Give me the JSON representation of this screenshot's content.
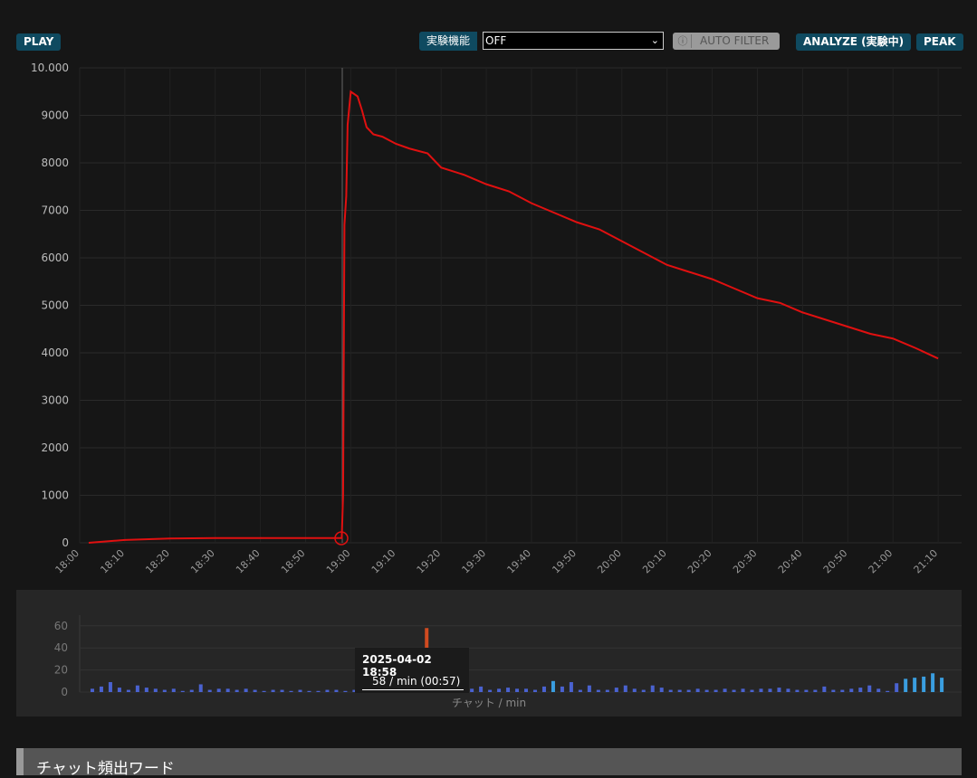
{
  "toolbar": {
    "play": "PLAY",
    "experimental_label": "実験機能",
    "select_value": "OFF",
    "auto_filter": "AUTO FILTER",
    "analyze": "ANALYZE (実験中)",
    "peak": "PEAK"
  },
  "tooltip": {
    "title": "2025-04-02 18:58",
    "value": "58 / min (00:57)"
  },
  "section": {
    "title": "チャット頻出ワード"
  },
  "colors": {
    "line": "#e01010",
    "bar": "#4a62d0",
    "bar_high": "#3a9ee0",
    "bar_peak": "#d04a20",
    "bar_hover": "#40d0b0"
  },
  "chart_data": [
    {
      "type": "line",
      "ylim": [
        0,
        10000
      ],
      "yticks": [
        "0",
        "1000",
        "2000",
        "3000",
        "4000",
        "5000",
        "6000",
        "7000",
        "8000",
        "9000",
        "10.000"
      ],
      "xticks": [
        "18:00",
        "18:10",
        "18:20",
        "18:30",
        "18:40",
        "18:50",
        "19:00",
        "19:10",
        "19:20",
        "19:30",
        "19:40",
        "19:50",
        "20:00",
        "20:10",
        "20:20",
        "20:30",
        "20:40",
        "20:50",
        "21:00",
        "21:10"
      ],
      "x_minutes": [
        2,
        10,
        20,
        30,
        40,
        50,
        57,
        58,
        58.3,
        58.6,
        59,
        59.3,
        60,
        61.5,
        62.5,
        63.5,
        65,
        67,
        70,
        73,
        77,
        80,
        85,
        90,
        95,
        100,
        105,
        110,
        115,
        120,
        125,
        130,
        135,
        140,
        145,
        150,
        155,
        160,
        165,
        170,
        175,
        180,
        185,
        190
      ],
      "values": [
        0,
        60,
        90,
        100,
        100,
        100,
        100,
        100,
        1000,
        6700,
        7300,
        8800,
        9500,
        9400,
        9100,
        8750,
        8600,
        8550,
        8400,
        8300,
        8200,
        7900,
        7750,
        7550,
        7400,
        7150,
        6950,
        6750,
        6600,
        6350,
        6100,
        5850,
        5700,
        5550,
        5350,
        5150,
        5050,
        4850,
        4700,
        4550,
        4400,
        4300,
        4100,
        3880
      ]
    },
    {
      "type": "bar",
      "ylim": [
        0,
        70
      ],
      "yticks": [
        "0",
        "20",
        "40",
        "60"
      ],
      "xlabel": "チャット / min",
      "x_start_minute": 3,
      "x_step_minutes": 2,
      "values": [
        3,
        5,
        9,
        4,
        2,
        6,
        4,
        3,
        2,
        3,
        1,
        2,
        7,
        2,
        3,
        3,
        2,
        3,
        2,
        1,
        2,
        2,
        1,
        2,
        1,
        1,
        2,
        2,
        1,
        2,
        3,
        2,
        2,
        3,
        5,
        6,
        13,
        58,
        5,
        17,
        12,
        11,
        3,
        5,
        2,
        3,
        4,
        3,
        3,
        2,
        5,
        10,
        5,
        9,
        2,
        6,
        2,
        2,
        4,
        6,
        3,
        2,
        6,
        4,
        2,
        2,
        2,
        3,
        2,
        2,
        3,
        2,
        3,
        2,
        3,
        3,
        4,
        3,
        2,
        2,
        2,
        5,
        2,
        2,
        3,
        4,
        6,
        3,
        1,
        8,
        12,
        13,
        14,
        17,
        13
      ]
    }
  ]
}
